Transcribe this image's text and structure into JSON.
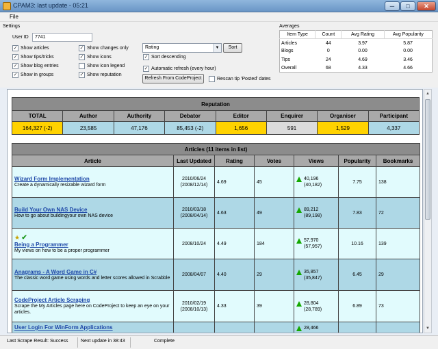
{
  "window": {
    "title": "CPAM3: last update - 05:21",
    "min": "─",
    "max": "□",
    "close": "✕"
  },
  "menu": {
    "file": "File"
  },
  "settings": {
    "group_label": "Settings",
    "user_id_label": "User ID",
    "user_id_value": "7741",
    "checks": [
      {
        "label": "Show articles",
        "checked": true
      },
      {
        "label": "Show tips/tricks",
        "checked": true
      },
      {
        "label": "Show blog entries",
        "checked": true
      },
      {
        "label": "Show in groups",
        "checked": true
      },
      {
        "label": "Show changes only",
        "checked": true
      },
      {
        "label": "Show icons",
        "checked": true
      },
      {
        "label": "Show icon legend",
        "checked": false
      },
      {
        "label": "Show reputation",
        "checked": true
      }
    ],
    "sort_field": "Rating",
    "sort_button": "Sort",
    "sort_descending": "Sort descending",
    "auto_refresh": "Automatic refresh (every hour)",
    "refresh_button": "Refresh From CodeProject",
    "rescan": "Rescan tip 'Posted' dates",
    "check_mark": "✓"
  },
  "averages": {
    "group_label": "Averages",
    "headers": [
      "Item Type",
      "Count",
      "Avg Rating",
      "Avg Popularity"
    ],
    "rows": [
      [
        "Articles",
        "44",
        "3.97",
        "5.87"
      ],
      [
        "Blogs",
        "0",
        "0.00",
        "0.00"
      ],
      [
        "Tips",
        "24",
        "4.69",
        "3.46"
      ],
      [
        "Overall",
        "68",
        "4.33",
        "4.66"
      ]
    ]
  },
  "reputation": {
    "title": "Reputation",
    "headers": [
      "TOTAL",
      "Author",
      "Authority",
      "Debator",
      "Editor",
      "Enquirer",
      "Organiser",
      "Participant"
    ],
    "values": [
      "164,327 (-2)",
      "23,585",
      "47,176",
      "85,453 (-2)",
      "1,656",
      "591",
      "1,529",
      "4,337"
    ]
  },
  "articles": {
    "title": "Articles (11 items in list)",
    "headers": [
      "Article",
      "Last Updated",
      "Rating",
      "Votes",
      "Views",
      "Popularity",
      "Bookmarks"
    ],
    "rows": [
      {
        "title": "Wizard Form Implementation",
        "desc": "Create a dynamically resizable wizard form",
        "updated": "2010/06/24",
        "updated_prev": "(2008/12/14)",
        "rating": "4.69",
        "votes": "45",
        "views": "40,196",
        "views_prev": "(40,182)",
        "popularity": "7.75",
        "bookmarks": "138"
      },
      {
        "title": "Build Your Own NAS Device",
        "desc": "How to go about buildingyour own NAS device",
        "updated": "2010/03/18",
        "updated_prev": "(2008/04/14)",
        "rating": "4.63",
        "votes": "49",
        "views": "89,212",
        "views_prev": "(89,198)",
        "popularity": "7.83",
        "bookmarks": "72"
      },
      {
        "title": "Being a Programmer",
        "desc": "My views on how to be a proper programmer",
        "updated": "2008/10/24",
        "updated_prev": "",
        "rating": "4.49",
        "votes": "184",
        "views": "57,970",
        "views_prev": "(57,957)",
        "popularity": "10.16",
        "bookmarks": "139",
        "star": "★",
        "check": "✔"
      },
      {
        "title": "Anagrams - A Word Game in C#",
        "desc": "The classic word game using words and letter scores allowed in Scrabble",
        "updated": "2008/04/07",
        "updated_prev": "",
        "rating": "4.40",
        "votes": "29",
        "views": "35,857",
        "views_prev": "(35,847)",
        "popularity": "6.45",
        "bookmarks": "29"
      },
      {
        "title": "CodeProject Article Scraping",
        "desc": "Scrape the My Articles page here on CodeProject to keep an eye on your articles.",
        "updated": "2010/02/19",
        "updated_prev": "(2008/10/13)",
        "rating": "4.33",
        "votes": "39",
        "views": "28,804",
        "views_prev": "(28,789)",
        "popularity": "6.89",
        "bookmarks": "73"
      },
      {
        "title": "User Login For WinForm Applications",
        "desc": "",
        "updated": "",
        "updated_prev": "",
        "rating": "",
        "votes": "",
        "views": "28,466",
        "views_prev": "",
        "popularity": "",
        "bookmarks": ""
      }
    ]
  },
  "status": {
    "scrape": "Last Scrape Result: Success",
    "next": "Next update in 38:43",
    "state": "Complete"
  }
}
